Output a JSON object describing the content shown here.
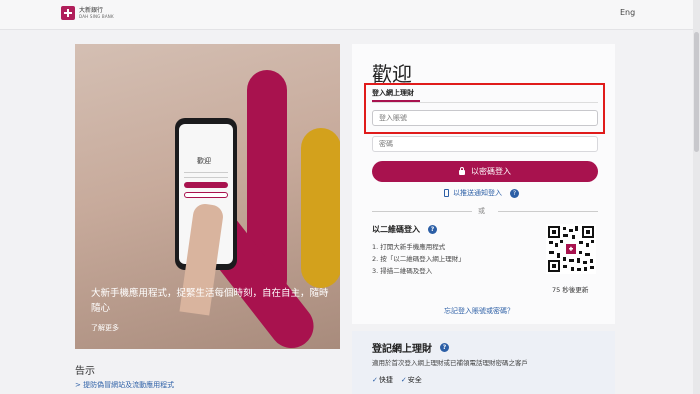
{
  "header": {
    "logo_zh": "大新銀行",
    "logo_en": "DAH SING BANK",
    "lang_link": "Eng"
  },
  "promo": {
    "phone_title": "歡迎",
    "caption": "大新手機應用程式，捉緊生活每個時刻，自在自主，隨時隨心",
    "more_link": "了解更多"
  },
  "notice": {
    "title": "告示",
    "link": "> 提防偽冒網站及流動應用程式"
  },
  "login": {
    "welcome": "歡迎",
    "tab_label": "登入網上理財",
    "account_placeholder": "登入賬號",
    "password_placeholder": "密碼",
    "password_button": "以密碼登入",
    "push_login": "以推送通知登入",
    "or_text": "或",
    "qr_title": "以二維碼登入",
    "qr_steps": [
      "1. 打開大新手機應用程式",
      "2. 按「以二維碼登入網上理財」",
      "3. 掃描二維碼及登入"
    ],
    "qr_refresh": "75 秒後更新",
    "forgot_link": "忘記登入賬號或密碼？"
  },
  "register": {
    "title": "登記網上理財",
    "description": "適用於首次登入網上理財或已補領電話理財密碼之客戶",
    "tags": [
      "快捷",
      "安全"
    ]
  },
  "colors": {
    "brand": "#a8124e",
    "link": "#2c5fa6",
    "highlight": "#e01b1b"
  }
}
